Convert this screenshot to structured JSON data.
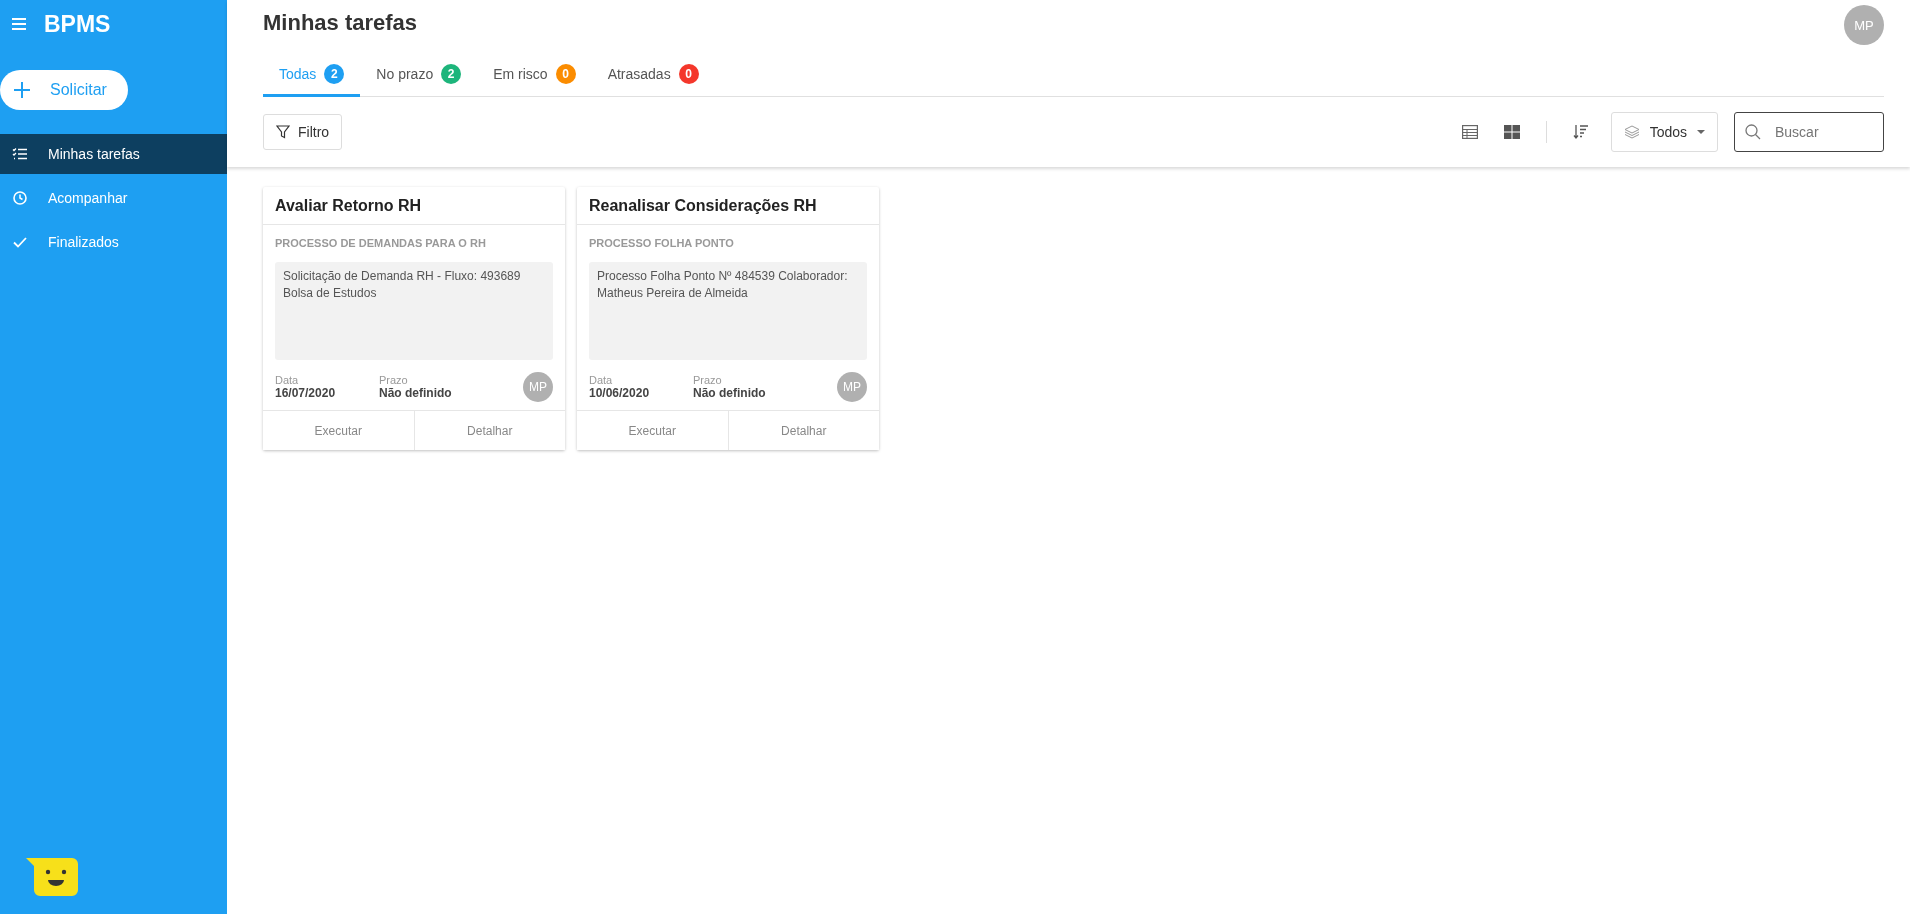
{
  "sidebar": {
    "logo": "BPMS",
    "new_button": "Solicitar",
    "items": [
      {
        "label": "Minhas tarefas",
        "kind": "checklist",
        "selected": true
      },
      {
        "label": "Acompanhar",
        "kind": "clock",
        "selected": false
      },
      {
        "label": "Finalizados",
        "kind": "check",
        "selected": false
      }
    ]
  },
  "header": {
    "title": "Minhas tarefas",
    "avatar": "MP"
  },
  "tabs": [
    {
      "label": "Todas",
      "count": "2",
      "color": "#1e9ff2",
      "selected": true
    },
    {
      "label": "No prazo",
      "count": "2",
      "color": "#1db57b",
      "selected": false
    },
    {
      "label": "Em risco",
      "count": "0",
      "color": "#fb8c00",
      "selected": false
    },
    {
      "label": "Atrasadas",
      "count": "0",
      "color": "#f4372b",
      "selected": false
    }
  ],
  "toolbar": {
    "filter": "Filtro",
    "view_selector": "Todos",
    "search": {
      "placeholder": "Buscar"
    }
  },
  "cards": [
    {
      "title": "Avaliar Retorno RH",
      "process": "PROCESSO DE DEMANDAS PARA O RH",
      "description": "Solicitação de Demanda RH - Fluxo: 493689 Bolsa de Estudos",
      "date_label": "Data",
      "date": "16/07/2020",
      "deadline_label": "Prazo",
      "deadline": "Não definido",
      "avatar": "MP",
      "actions": [
        "Executar",
        "Detalhar"
      ]
    },
    {
      "title": "Reanalisar Considerações RH",
      "process": "PROCESSO FOLHA PONTO",
      "description": "Processo Folha Ponto Nº 484539 Colaborador: Matheus Pereira de Almeida",
      "date_label": "Data",
      "date": "10/06/2020",
      "deadline_label": "Prazo",
      "deadline": "Não definido",
      "avatar": "MP",
      "actions": [
        "Executar",
        "Detalhar"
      ]
    }
  ]
}
